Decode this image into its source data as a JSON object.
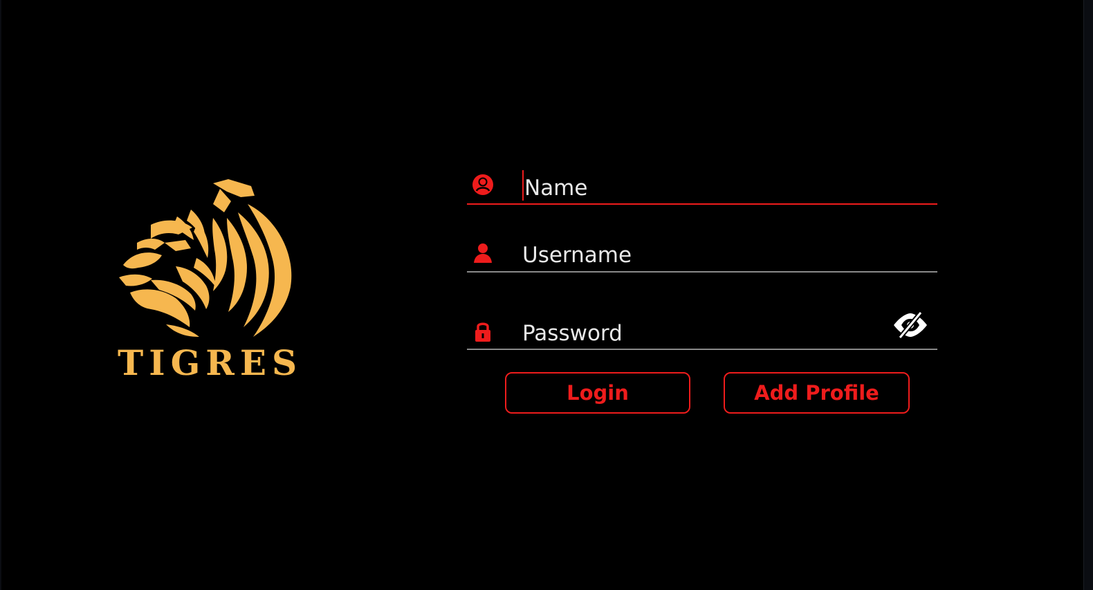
{
  "brand": {
    "name": "TIGRES",
    "logo_icon": "tiger-head-icon",
    "logo_color": "#f6b74f"
  },
  "form": {
    "name_field": {
      "placeholder": "Name",
      "icon": "user-circle-icon"
    },
    "username_field": {
      "placeholder": "Username",
      "icon": "user-icon"
    },
    "password_field": {
      "placeholder": "Password",
      "icon": "lock-icon",
      "toggle_icon": "eye-off-icon"
    },
    "login_label": "Login",
    "add_profile_label": "Add Profile"
  },
  "colors": {
    "background": "#000000",
    "accent": "#ee1c1c",
    "text": "#e8e8e8",
    "underline_inactive": "#8a8a8a"
  }
}
